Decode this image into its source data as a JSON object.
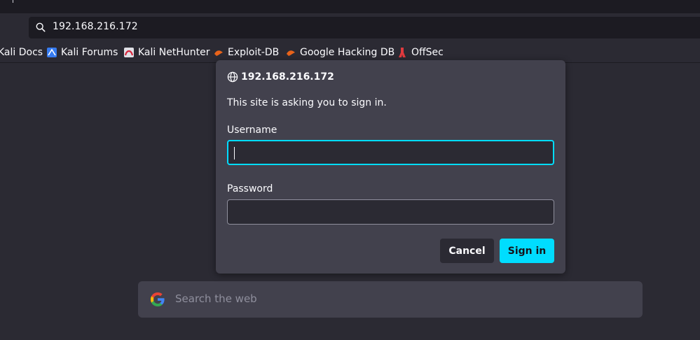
{
  "browser": {
    "url": "192.168.216.172",
    "icons": {
      "url_search": "search-icon"
    }
  },
  "bookmarks": [
    {
      "label": "Kali Docs",
      "icon": "none"
    },
    {
      "label": "Kali Forums",
      "icon": "kali-forums-icon"
    },
    {
      "label": "Kali NetHunter",
      "icon": "kali-nethunter-icon"
    },
    {
      "label": "Exploit-DB",
      "icon": "exploit-db-icon"
    },
    {
      "label": "Google Hacking DB",
      "icon": "ghdb-icon"
    },
    {
      "label": "OffSec",
      "icon": "offsec-icon"
    }
  ],
  "auth_dialog": {
    "host": "192.168.216.172",
    "message": "This site is asking you to sign in.",
    "username_label": "Username",
    "username_value": "",
    "password_label": "Password",
    "password_value": "",
    "cancel_label": "Cancel",
    "signin_label": "Sign in",
    "accent_color": "#00ddff"
  },
  "web_search": {
    "placeholder": "Search the web",
    "icon": "google-icon"
  }
}
